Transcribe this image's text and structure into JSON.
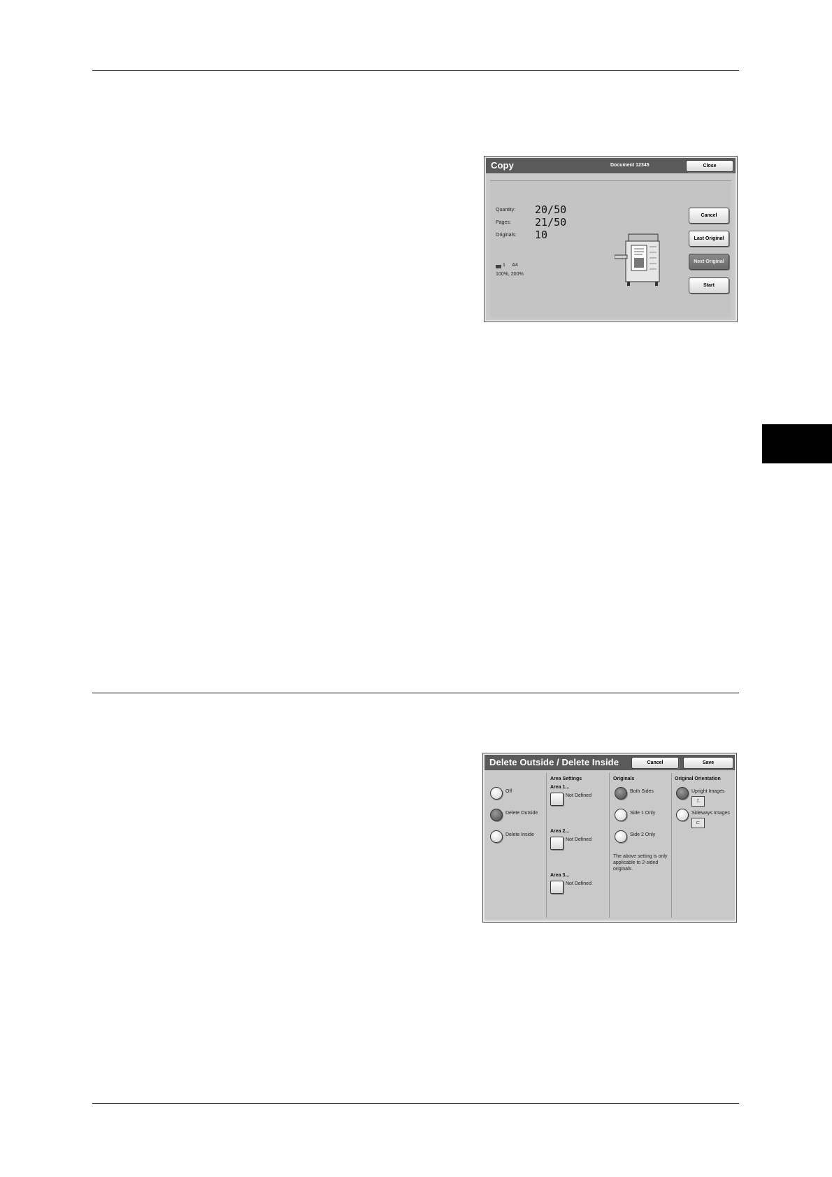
{
  "copy_screen": {
    "title": "Copy",
    "document": "Document 12345",
    "close_label": "Close",
    "quantity_label": "Quantity:",
    "quantity_value": "20/50",
    "pages_label": "Pages:",
    "pages_value": "21/50",
    "originals_label": "Originals:",
    "originals_value": "10",
    "tray_info": "1     A4",
    "ratio_info": "100%, 200%",
    "buttons": [
      "Cancel",
      "Last Original",
      "Next Original",
      "Start"
    ]
  },
  "delete_screen": {
    "title": "Delete Outside / Delete Inside",
    "cancel_label": "Cancel",
    "save_label": "Save",
    "mode_options": [
      "Off",
      "Delete Outside",
      "Delete Inside"
    ],
    "mode_selected": "Delete Outside",
    "area_settings": {
      "heading": "Area Settings",
      "areas": [
        {
          "label": "Area 1...",
          "status": "Not Defined"
        },
        {
          "label": "Area 2...",
          "status": "Not Defined"
        },
        {
          "label": "Area 3...",
          "status": "Not Defined"
        }
      ]
    },
    "originals": {
      "heading": "Originals",
      "options": [
        "Both Sides",
        "Side 1 Only",
        "Side 2 Only"
      ],
      "selected": "Both Sides",
      "note": "The above setting is only applicable to 2-sided originals."
    },
    "orientation": {
      "heading": "Original Orientation",
      "options": [
        "Upright Images",
        "Sideways Images"
      ],
      "selected": "Upright Images"
    }
  }
}
